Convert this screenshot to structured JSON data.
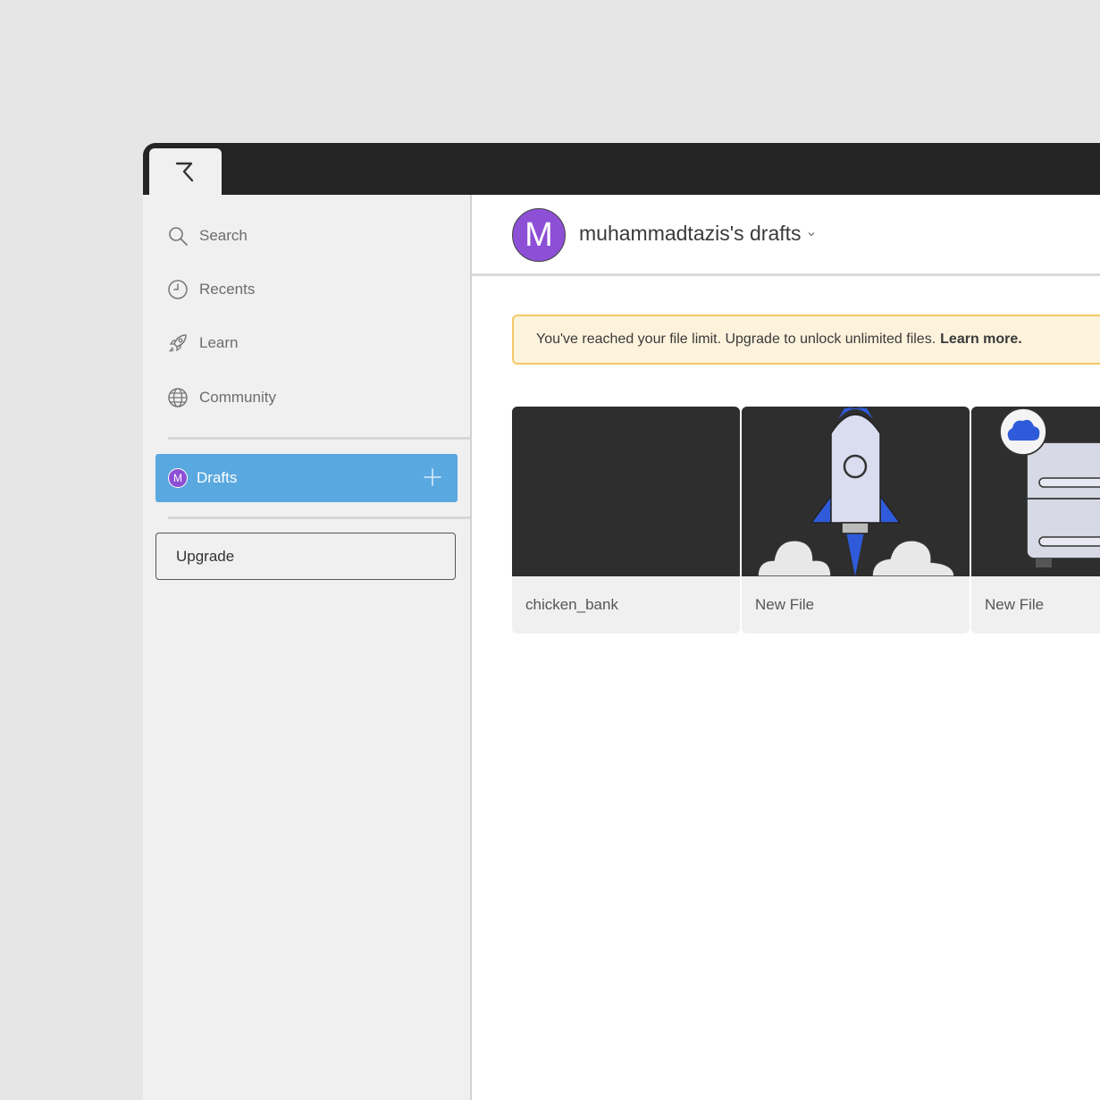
{
  "sidebar": {
    "nav": [
      {
        "label": "Search",
        "icon": "search-icon"
      },
      {
        "label": "Recents",
        "icon": "clock-icon"
      },
      {
        "label": "Learn",
        "icon": "rocket-icon"
      },
      {
        "label": "Community",
        "icon": "globe-icon"
      }
    ],
    "drafts": {
      "label": "Drafts",
      "avatar_initial": "M"
    },
    "upgrade_label": "Upgrade"
  },
  "header": {
    "avatar_initial": "M",
    "team_name": "muhammadtazis's drafts"
  },
  "banner": {
    "message": "You've reached your file limit. Upgrade to unlock unlimited files.",
    "link": "Learn more."
  },
  "files": [
    {
      "name": "chicken_bank",
      "thumbnail": "blank"
    },
    {
      "name": "New File",
      "thumbnail": "rocket-illustration"
    },
    {
      "name": "New File",
      "thumbnail": "cloud-server-illustration"
    }
  ],
  "colors": {
    "accent": "#5aa8e0",
    "avatar": "#8d4fd6",
    "banner_bg": "#fdf2dc",
    "banner_border": "#f4c865",
    "titlebar": "#242424"
  }
}
